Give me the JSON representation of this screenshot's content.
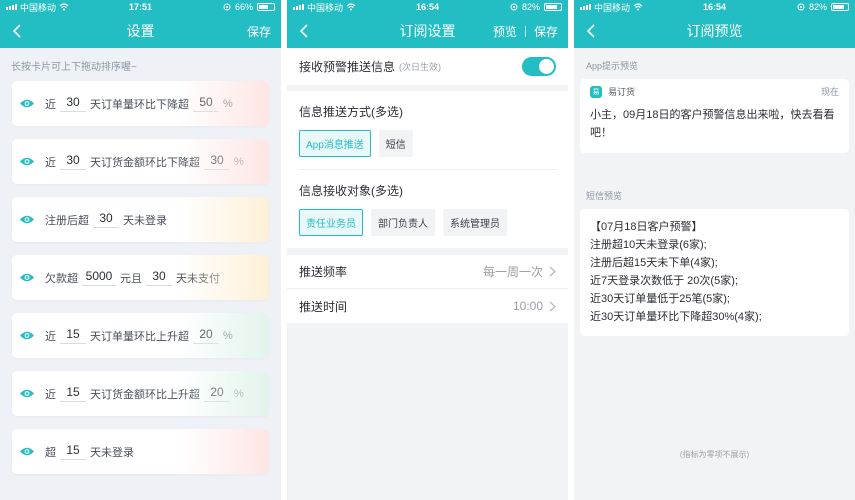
{
  "screen1": {
    "status": {
      "carrier": "中国移动",
      "time": "17:51",
      "battery": "66%"
    },
    "nav": {
      "title": "设置",
      "save": "保存"
    },
    "hint": "长按卡片可上下拖动排序喔~",
    "cards": [
      {
        "pre": "近",
        "v1": "30",
        "mid": "天订单量环比下降超",
        "v2": "50",
        "post": "%",
        "tint": "#fde6e4"
      },
      {
        "pre": "近",
        "v1": "30",
        "mid": "天订货金额环比下降超",
        "v2": "30",
        "post": "%",
        "tint": "#fde6e4"
      },
      {
        "pre": "注册后超",
        "v1": "30",
        "mid": "天未登录",
        "tint": "#fdf0d8"
      },
      {
        "pre": "欠款超",
        "v1": "5000",
        "mid": "元且",
        "v2": "30",
        "post": "天未支付",
        "tint": "#fdf0d8"
      },
      {
        "pre": "近",
        "v1": "15",
        "mid": "天订单量环比上升超",
        "v2": "20",
        "post": "%",
        "tint": "#e2f4ec"
      },
      {
        "pre": "近",
        "v1": "15",
        "mid": "天订货金额环比上升超",
        "v2": "20",
        "post": "%",
        "tint": "#e2f4ec"
      },
      {
        "pre": "超",
        "v1": "15",
        "mid": "天未登录",
        "tint": "#fde6e4"
      }
    ]
  },
  "screen2": {
    "status": {
      "carrier": "中国移动",
      "time": "16:54",
      "battery": "82%"
    },
    "nav": {
      "title": "订阅设置",
      "preview": "预览",
      "save": "保存"
    },
    "receive": {
      "label": "接收预警推送信息",
      "note": "(次日生效)",
      "enabled": true
    },
    "method": {
      "title": "信息推送方式",
      "note": "(多选)",
      "options": [
        "App消息推送",
        "短信"
      ],
      "selected": "App消息推送"
    },
    "target": {
      "title": "信息接收对象",
      "note": "(多选)",
      "options": [
        "责任业务员",
        "部门负责人",
        "系统管理员"
      ],
      "selected": "责任业务员"
    },
    "frequency": {
      "label": "推送频率",
      "value": "每一周一次"
    },
    "time": {
      "label": "推送时间",
      "value": "10:00"
    }
  },
  "screen3": {
    "status": {
      "carrier": "中国移动",
      "time": "16:54",
      "battery": "82%"
    },
    "nav": {
      "title": "订阅预览"
    },
    "app_section": "App提示预览",
    "app_card": {
      "app_name": "易订货",
      "when": "现在",
      "message": "小主，09月18日的客户预警信息出来啦，快去看看吧！"
    },
    "sms_section": "短信预览",
    "sms_lines": [
      "【07月18日客户预警】",
      "注册超10天未登录(6家);",
      "注册后超15天未下单(4家);",
      "近7天登录次数低于 20次(5家);",
      "近30天订单量低于25笔(5家);",
      "近30天订单量环比下降超30%(4家);"
    ],
    "footer": "(指标为零项不展示)",
    "colors": {
      "brand": "#22bec3"
    }
  }
}
